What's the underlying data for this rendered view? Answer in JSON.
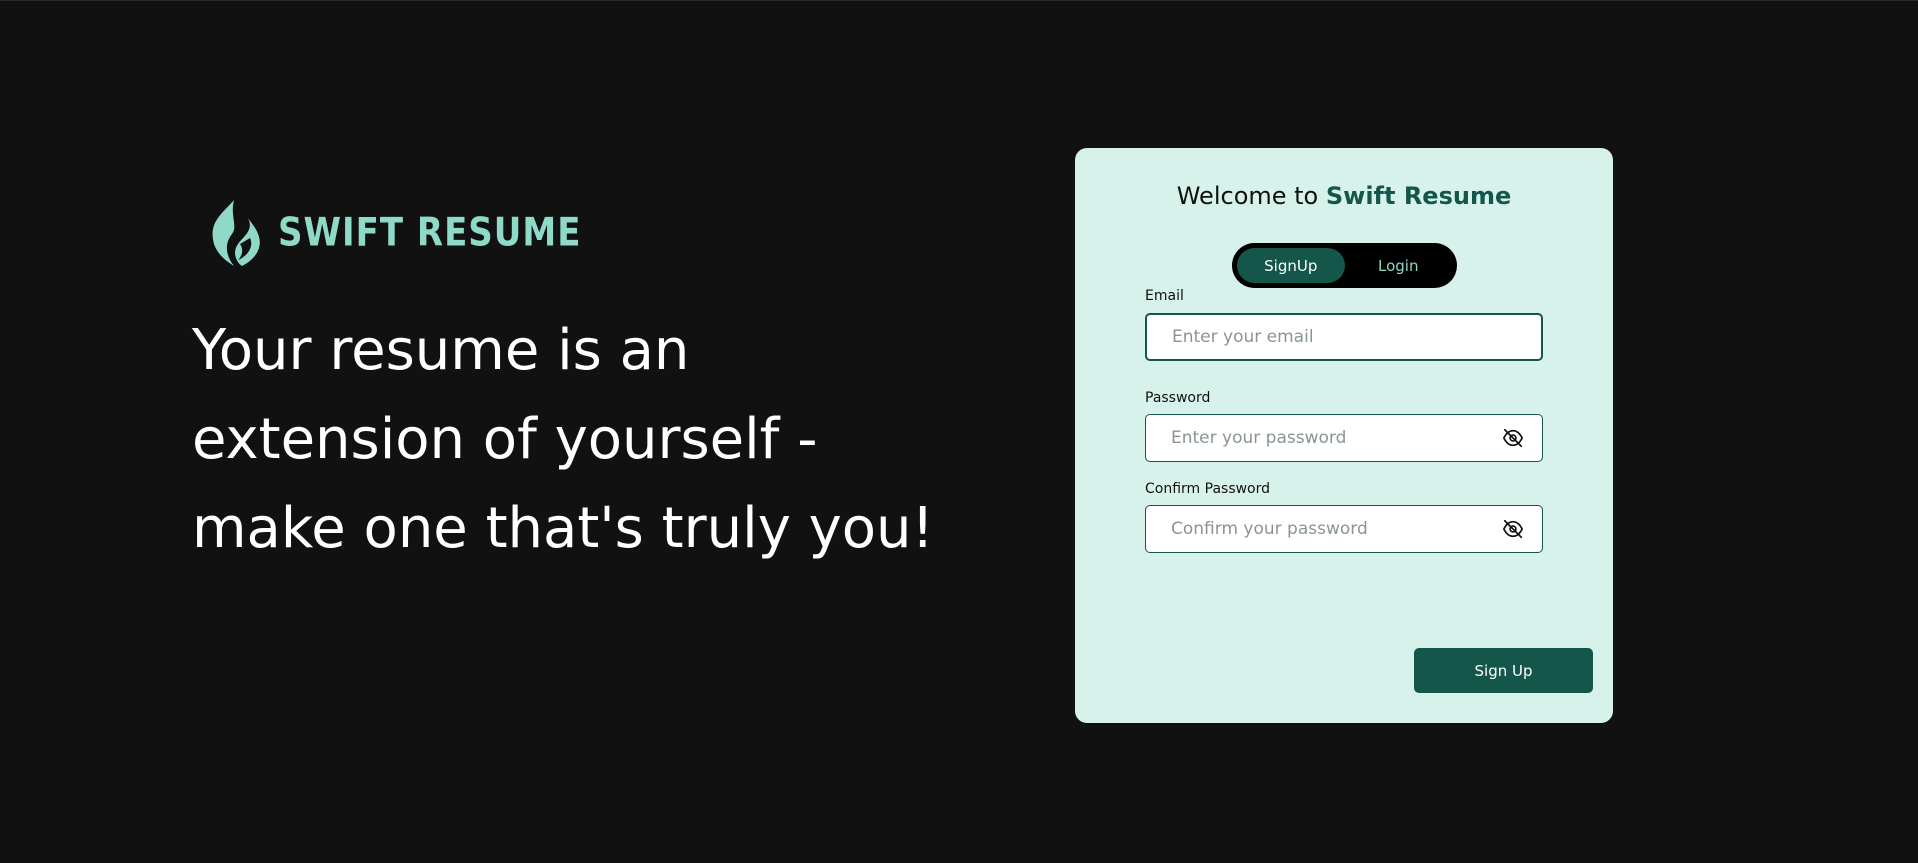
{
  "brand": {
    "name": "SWIFT RESUME",
    "logo_icon": "flame-logo-icon"
  },
  "hero": {
    "tagline_line1": "Your resume is an",
    "tagline_line2": "extension of yourself -",
    "tagline_line3": "make one that's truly you!"
  },
  "card": {
    "welcome_prefix": "Welcome to ",
    "welcome_brand": "Swift Resume",
    "tabs": [
      {
        "label": "SignUp",
        "active": true
      },
      {
        "label": "Login",
        "active": false
      }
    ],
    "fields": {
      "email": {
        "label": "Email",
        "placeholder": "Enter your email",
        "value": ""
      },
      "password": {
        "label": "Password",
        "placeholder": "Enter your password",
        "value": "",
        "toggle_icon": "eye-off-icon"
      },
      "confirm": {
        "label": "Confirm Password",
        "placeholder": "Confirm your password",
        "value": "",
        "toggle_icon": "eye-off-icon"
      }
    },
    "submit_label": "Sign Up"
  },
  "colors": {
    "background": "#111111",
    "accent_dark": "#14574a",
    "accent_light": "#8fd9c8",
    "card_bg": "#d6f2eb"
  }
}
